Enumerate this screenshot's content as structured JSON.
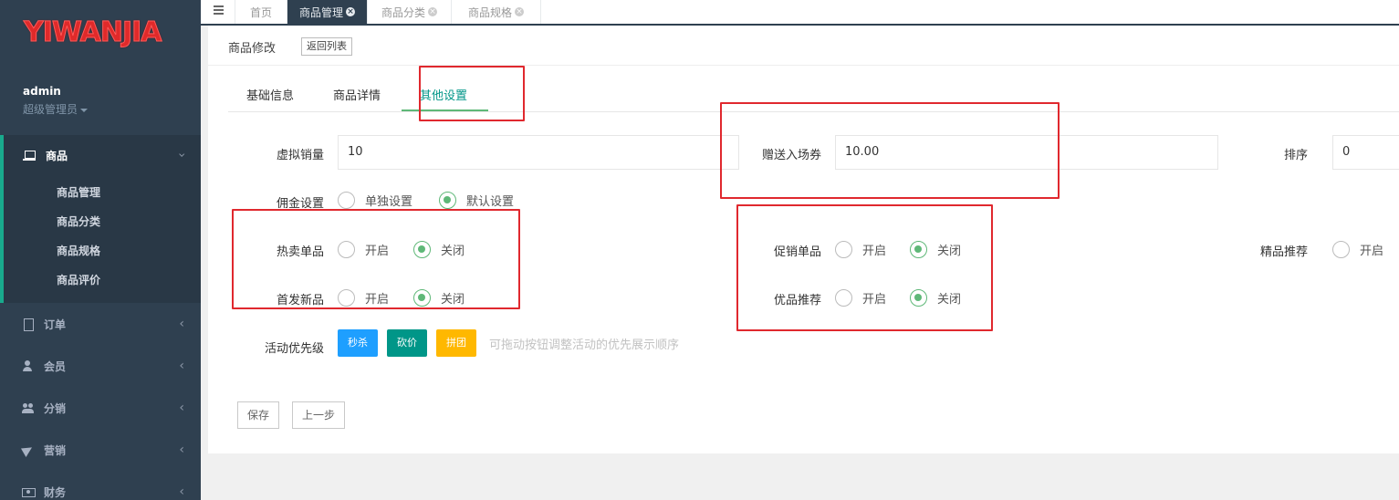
{
  "sidebar": {
    "logo": "YIWANJIA",
    "user": {
      "name": "admin",
      "role": "超级管理员"
    },
    "menu": [
      {
        "label": "商品",
        "icon": "laptop-icon",
        "expanded": true,
        "children": [
          "商品管理",
          "商品分类",
          "商品规格",
          "商品评价"
        ]
      },
      {
        "label": "订单",
        "icon": "file-icon"
      },
      {
        "label": "会员",
        "icon": "user-icon"
      },
      {
        "label": "分销",
        "icon": "users-icon"
      },
      {
        "label": "营销",
        "icon": "paper-plane-icon"
      },
      {
        "label": "财务",
        "icon": "money-icon"
      }
    ]
  },
  "topbar": {
    "menu_icon": "hamburger-icon",
    "tabs": [
      {
        "label": "首页",
        "active": false,
        "closable": false
      },
      {
        "label": "商品管理",
        "active": true,
        "closable": true
      },
      {
        "label": "商品分类",
        "active": false,
        "closable": true
      },
      {
        "label": "商品规格",
        "active": false,
        "closable": true
      }
    ]
  },
  "panel": {
    "title": "商品修改",
    "back_label": "返回列表",
    "tabs": [
      {
        "label": "基础信息",
        "active": false
      },
      {
        "label": "商品详情",
        "active": false
      },
      {
        "label": "其他设置",
        "active": true
      }
    ]
  },
  "form": {
    "virtual_sales": {
      "label": "虚拟销量",
      "value": "10"
    },
    "gift_ticket": {
      "label": "赠送入场券",
      "value": "10.00"
    },
    "sort": {
      "label": "排序",
      "value": "0"
    },
    "commission": {
      "label": "佣金设置",
      "options": [
        "单独设置",
        "默认设置"
      ],
      "selected": "默认设置"
    },
    "hot": {
      "label": "热卖单品",
      "options": [
        "开启",
        "关闭"
      ],
      "selected": "关闭"
    },
    "promo": {
      "label": "促销单品",
      "options": [
        "开启",
        "关闭"
      ],
      "selected": "关闭"
    },
    "boutique": {
      "label": "精品推荐",
      "options": [
        "开启"
      ],
      "selected": ""
    },
    "new_release": {
      "label": "首发新品",
      "options": [
        "开启",
        "关闭"
      ],
      "selected": "关闭"
    },
    "quality": {
      "label": "优品推荐",
      "options": [
        "开启",
        "关闭"
      ],
      "selected": "关闭"
    },
    "activity": {
      "label": "活动优先级",
      "buttons": [
        {
          "label": "秒杀",
          "color": "#1e9fff"
        },
        {
          "label": "砍价",
          "color": "#009688"
        },
        {
          "label": "拼团",
          "color": "#ffb800"
        }
      ],
      "hint": "可拖动按钮调整活动的优先展示顺序"
    },
    "save_label": "保存",
    "prev_label": "上一步"
  },
  "colors": {
    "sidebar_bg": "#2f4050",
    "accent": "#5fb878",
    "highlight_box": "#e0282e"
  }
}
